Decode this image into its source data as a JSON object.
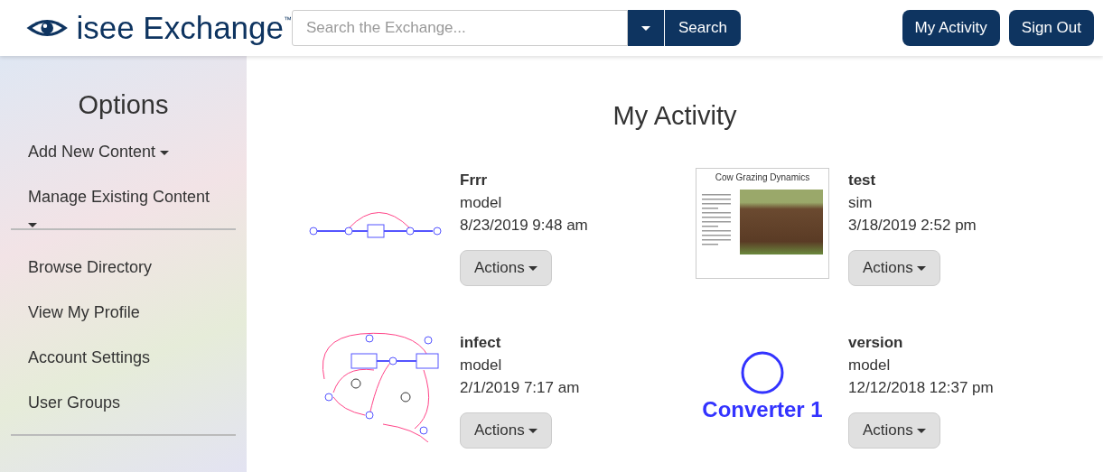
{
  "header": {
    "logo_text": "isee Exchange",
    "trademark": "™",
    "search": {
      "placeholder": "Search the Exchange..."
    },
    "search_button": "Search",
    "nav_buttons": [
      "My Activity",
      "Sign Out"
    ]
  },
  "sidebar": {
    "title": "Options",
    "menus": [
      {
        "label": "Add New Content"
      },
      {
        "label": "Manage Existing Content"
      }
    ],
    "links": [
      "Browse Directory",
      "View My Profile",
      "Account Settings",
      "User Groups"
    ]
  },
  "main": {
    "title": "My Activity",
    "items": [
      {
        "name": "Frrr",
        "type": "model",
        "date": "8/23/2019 9:48 am",
        "actions": "Actions",
        "thumbnail": {
          "kind": "stockflow"
        }
      },
      {
        "name": "test",
        "type": "sim",
        "date": "3/18/2019 2:52 pm",
        "actions": "Actions",
        "thumbnail": {
          "kind": "sim",
          "title": "Cow Grazing Dynamics"
        }
      },
      {
        "name": "infect",
        "type": "model",
        "date": "2/1/2019 7:17 am",
        "actions": "Actions",
        "thumbnail": {
          "kind": "causal"
        }
      },
      {
        "name": "version",
        "type": "model",
        "date": "12/12/2018 12:37 pm",
        "actions": "Actions",
        "thumbnail": {
          "kind": "converter",
          "label": "Converter 1"
        }
      }
    ]
  }
}
